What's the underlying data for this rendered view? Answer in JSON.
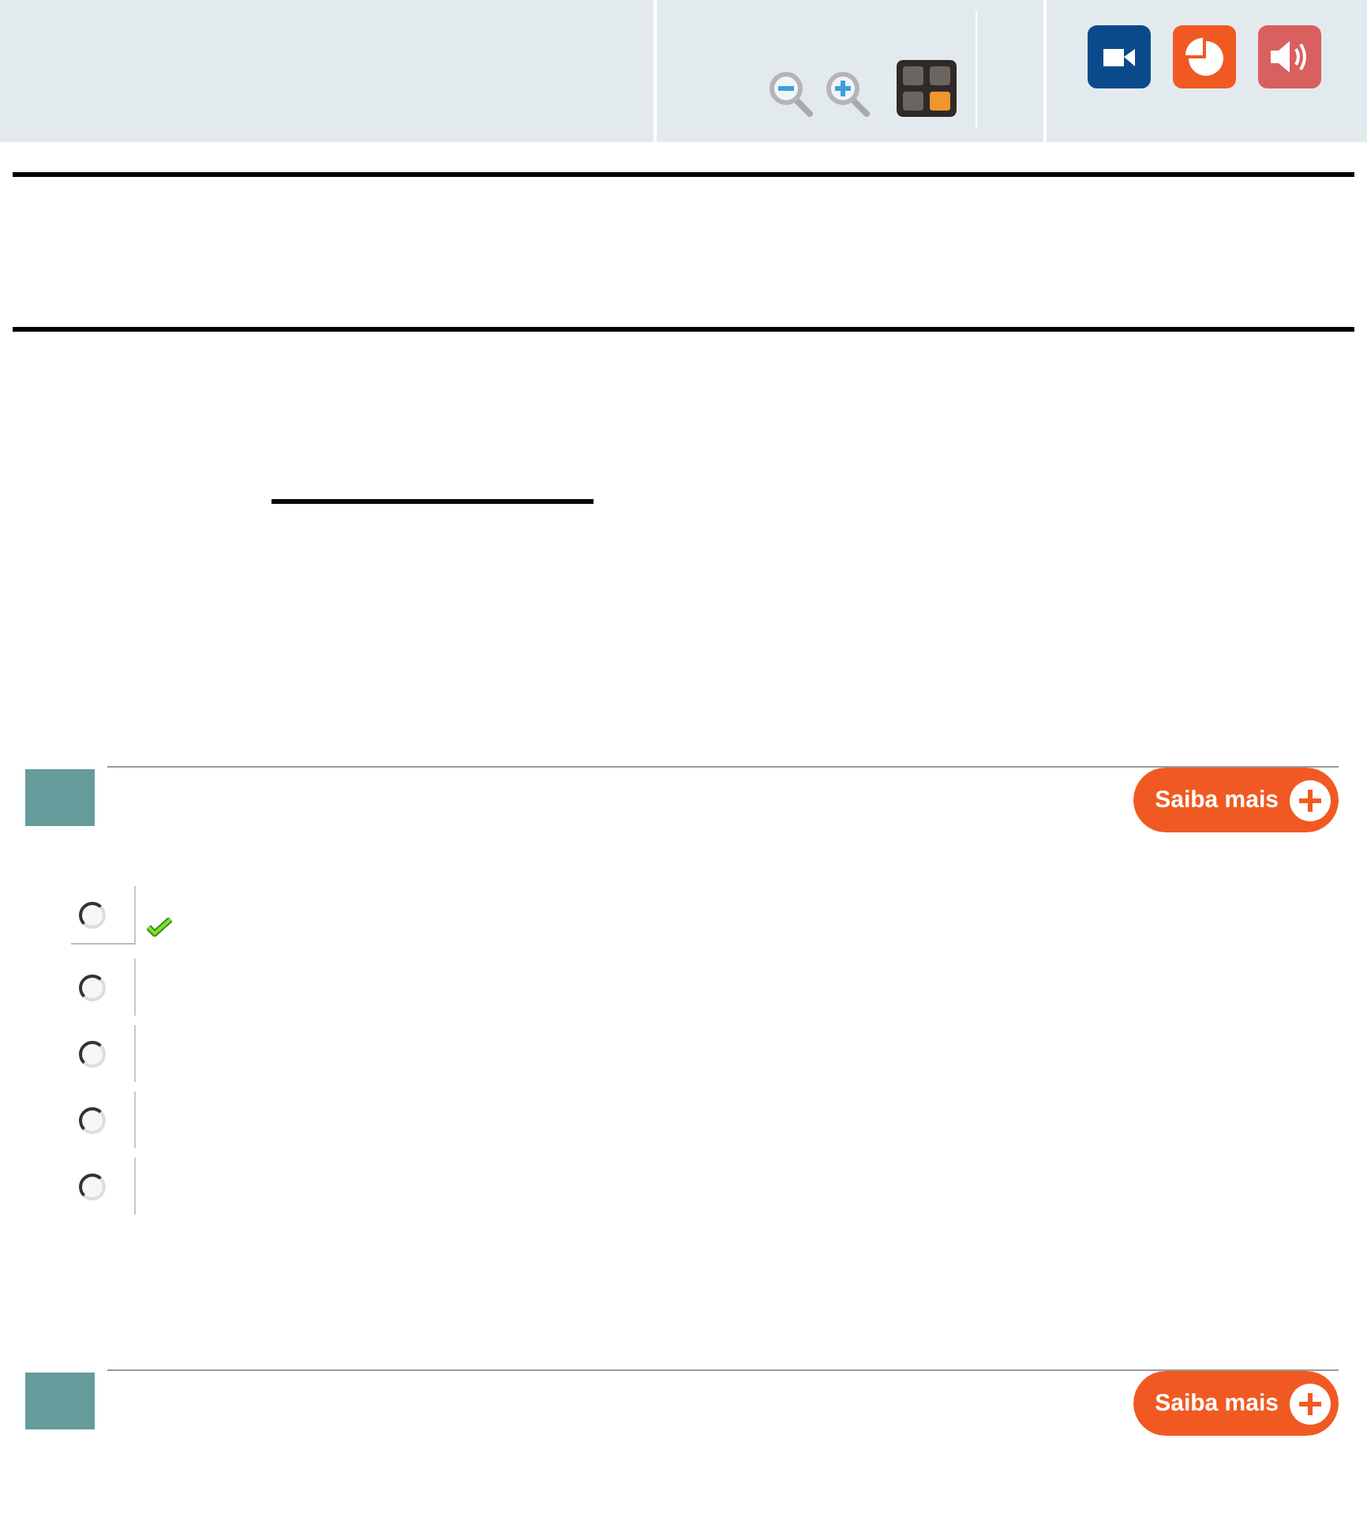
{
  "questions": [
    {
      "button": "Saiba mais",
      "options": [
        {
          "selected": false,
          "correct": true
        },
        {
          "selected": false,
          "correct": false
        },
        {
          "selected": false,
          "correct": false
        },
        {
          "selected": false,
          "correct": false
        },
        {
          "selected": false,
          "correct": false
        }
      ]
    },
    {
      "button": "Saiba mais"
    }
  ]
}
